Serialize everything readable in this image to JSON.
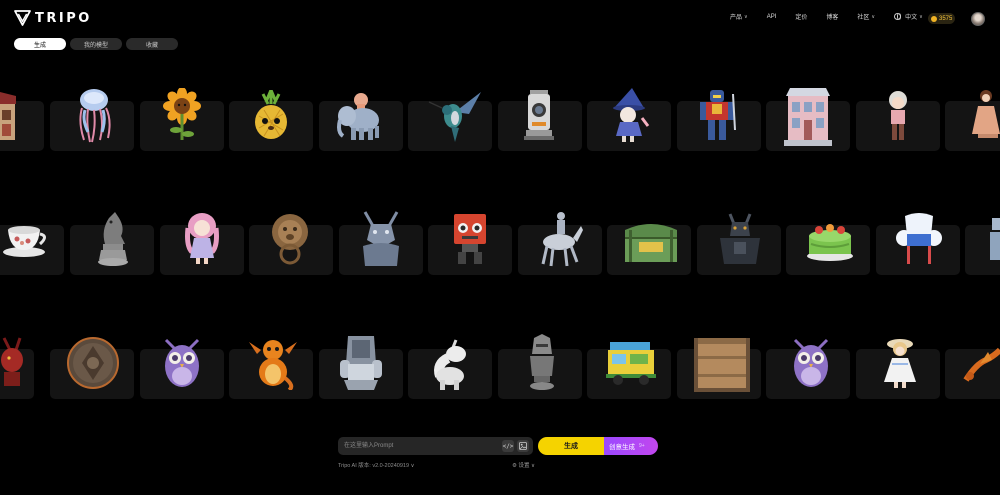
{
  "app": {
    "name": "TRIPO"
  },
  "nav": [
    {
      "label": "产品",
      "dropdown": true
    },
    {
      "label": "API",
      "dropdown": false
    },
    {
      "label": "定价",
      "dropdown": false
    },
    {
      "label": "博客",
      "dropdown": false
    },
    {
      "label": "社区",
      "dropdown": true
    }
  ],
  "language": {
    "label": "中文"
  },
  "credits": {
    "value": "3575"
  },
  "tabs": [
    {
      "label": "生成",
      "active": true
    },
    {
      "label": "我的模型",
      "active": false
    },
    {
      "label": "收藏",
      "active": false
    }
  ],
  "gallery": {
    "rows": [
      {
        "items": [
          "teahouse",
          "jellyfish",
          "sunflower",
          "pineapple-hedgehog",
          "elephant",
          "hummingbird",
          "robot-scanner",
          "witch-kitty",
          "warrior-robot",
          "pink-house",
          "anime-boy",
          "woman-dress"
        ]
      },
      {
        "items": [
          "teacup",
          "chess-knight",
          "pink-girl",
          "lion-knocker",
          "dragon-bust",
          "red-robot",
          "horse-rider",
          "treasure-chest",
          "armored-beast",
          "green-cake",
          "ice-throne",
          "partial-figure"
        ]
      },
      {
        "items": [
          "red-demon",
          "coin",
          "owl",
          "orange-dragon",
          "space-chair",
          "unicorn",
          "knight-bust",
          "food-truck",
          "wooden-crate",
          "owl-2",
          "girl-dress",
          "dragon-tail"
        ]
      }
    ]
  },
  "prompt": {
    "placeholder": "在这里输入Prompt",
    "code_icon": "</>",
    "image_icon": "image-upload-icon"
  },
  "actions": {
    "generate": "生成",
    "create": "创意生成",
    "create_extra": "9+"
  },
  "footer": {
    "version": "Tripo AI 版本: v2.0-20240919 ∨",
    "settings": "⚙ 设置 ∨"
  },
  "colors": {
    "accent": "#f5d300",
    "purple": "#b046f2",
    "background": "#000000",
    "card": "#141414"
  }
}
